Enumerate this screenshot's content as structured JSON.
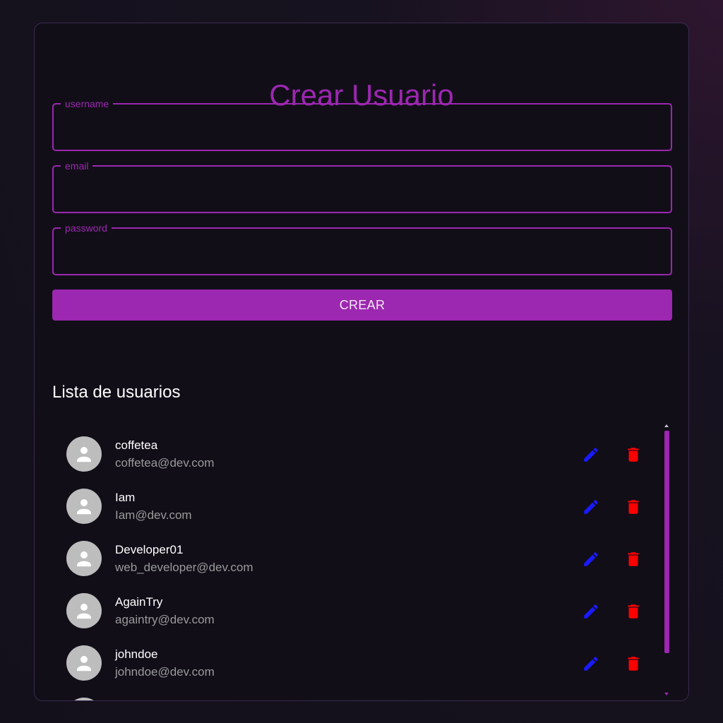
{
  "form": {
    "title": "Crear Usuario",
    "fields": [
      {
        "label": "username",
        "value": ""
      },
      {
        "label": "email",
        "value": ""
      },
      {
        "label": "password",
        "value": ""
      }
    ],
    "submit_label": "CREAR"
  },
  "list": {
    "title": "Lista de usuarios",
    "users": [
      {
        "name": "coffetea",
        "email": "coffetea@dev.com"
      },
      {
        "name": "Iam",
        "email": "Iam@dev.com"
      },
      {
        "name": "Developer01",
        "email": "web_developer@dev.com"
      },
      {
        "name": "AgainTry",
        "email": "againtry@dev.com"
      },
      {
        "name": "johndoe",
        "email": "johndoe@dev.com"
      }
    ],
    "row_icons": {
      "avatar": "person-icon",
      "edit": "pencil-icon",
      "delete": "trash-icon"
    }
  },
  "colors": {
    "accent": "#9c27b0",
    "edit": "#1a1aff",
    "delete": "#ff0000",
    "avatar": "#bdbdbd"
  }
}
